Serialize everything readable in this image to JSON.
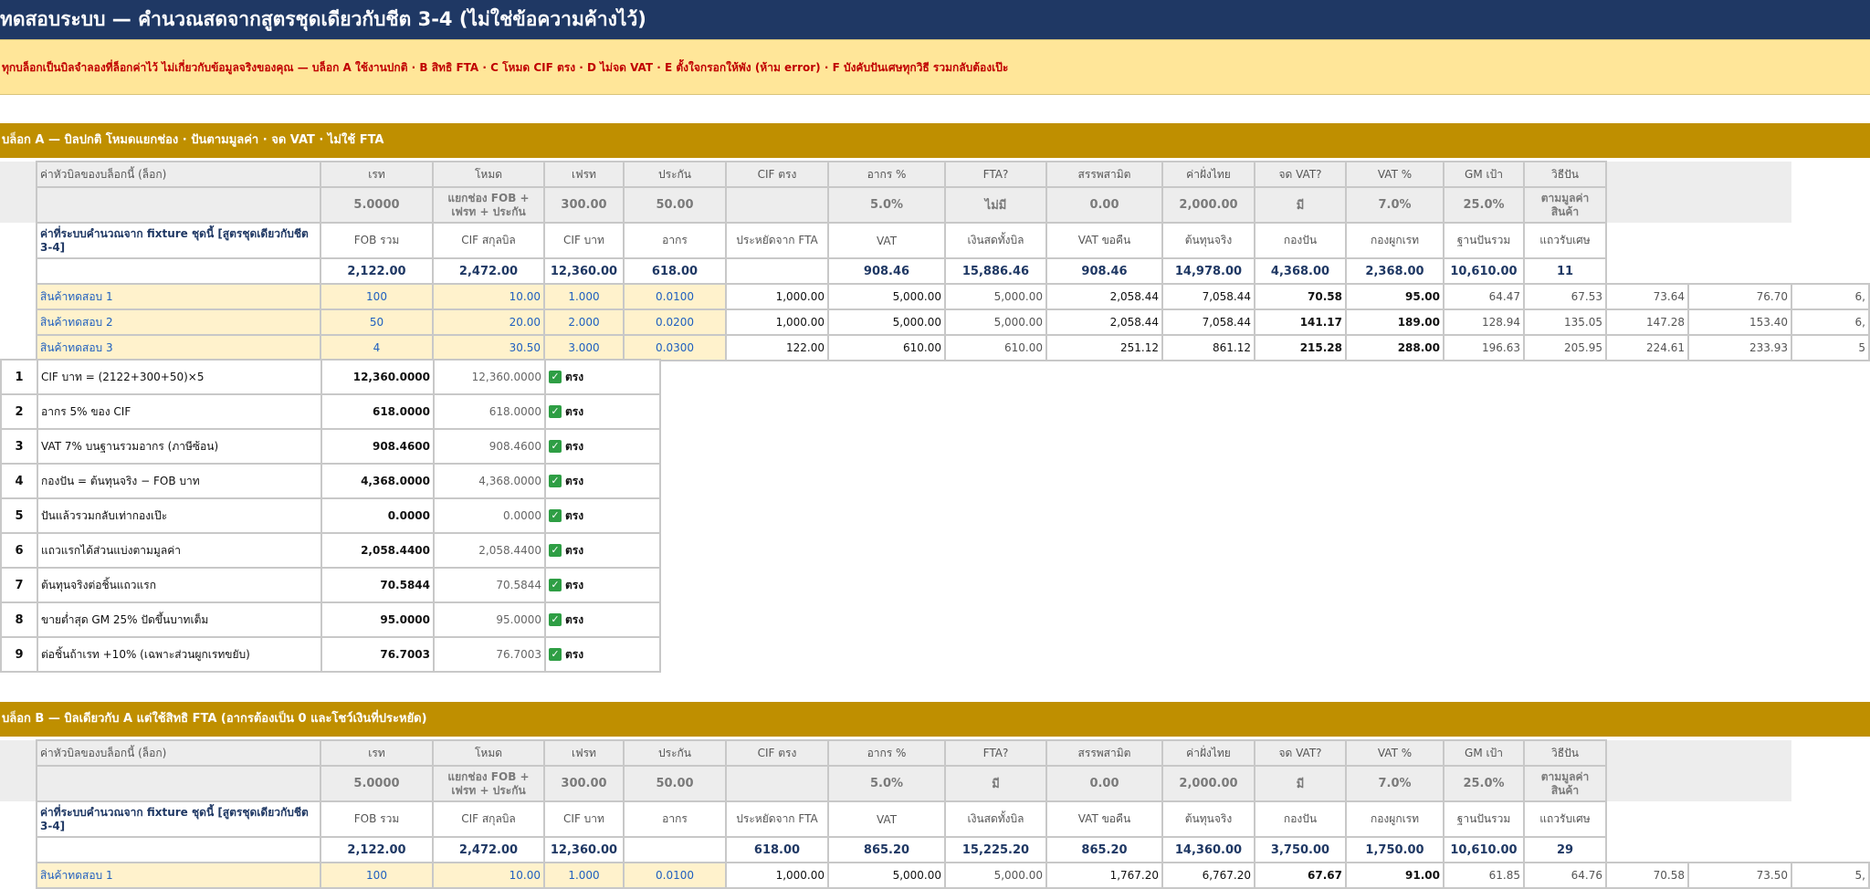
{
  "title": "ทดสอบระบบ — คำนวณสดจากสูตรชุดเดียวกับชีต 3-4 (ไม่ใช่ข้อความค้างไว้)",
  "notice": "ทุกบล็อกเป็นบิลจำลองที่ล็อกค่าไว้ ไม่เกี่ยวกับข้อมูลจริงของคุณ — บล็อก A ใช้งานปกติ · B สิทธิ FTA · C โหมด CIF ตรง · D ไม่จด VAT · E ตั้งใจกรอกให้พัง (ห้าม error) · F บังคับปันเศษทุกวิธี รวมกลับต้องเป๊ะ",
  "headers1": [
    "ค่าหัวบิลของบล็อกนี้ (ล็อก)",
    "เรท",
    "โหมด",
    "เฟรท",
    "ประกัน",
    "CIF ตรง",
    "อากร %",
    "FTA?",
    "สรรพสามิต",
    "ค่าฝั่งไทย",
    "จด VAT?",
    "VAT %",
    "GM เป้า",
    "วิธีปัน"
  ],
  "headers2": [
    "ค่าที่ระบบคำนวณจาก fixture ชุดนี้ [สูตรชุดเดียวกับชีต 3-4]",
    "FOB รวม",
    "CIF สกุลบิล",
    "CIF บาท",
    "อากร",
    "ประหยัดจาก FTA",
    "VAT",
    "เงินสดทั้งบิล",
    "VAT ขอคืน",
    "ต้นทุนจริง",
    "กองปัน",
    "กองผูกเรท",
    "ฐานปันรวม",
    "แถวรับเศษ"
  ],
  "block_a": {
    "title": "บล็อก A — บิลปกติ โหมดแยกช่อง · ปันตามมูลค่า · จด VAT · ไม่ใช้ FTA",
    "inputs": [
      "5.0000",
      "แยกช่อง FOB + เฟรท + ประกัน",
      "300.00",
      "50.00",
      "",
      "5.0%",
      "ไม่มี",
      "0.00",
      "2,000.00",
      "มี",
      "7.0%",
      "25.0%",
      "ตามมูลค่า สินค้า"
    ],
    "totals": [
      "2,122.00",
      "2,472.00",
      "12,360.00",
      "618.00",
      "",
      "908.46",
      "15,886.46",
      "908.46",
      "14,978.00",
      "4,368.00",
      "2,368.00",
      "10,610.00",
      "11"
    ],
    "items": [
      {
        "name": "สินค้าทดสอบ 1",
        "cells": [
          "100",
          "10.00",
          "1.000",
          "0.0100",
          "1,000.00",
          "5,000.00",
          "5,000.00",
          "2,058.44",
          "7,058.44",
          "70.58",
          "95.00",
          "64.47",
          "67.53",
          "73.64",
          "76.70",
          "6,"
        ]
      },
      {
        "name": "สินค้าทดสอบ 2",
        "cells": [
          "50",
          "20.00",
          "2.000",
          "0.0200",
          "1,000.00",
          "5,000.00",
          "5,000.00",
          "2,058.44",
          "7,058.44",
          "141.17",
          "189.00",
          "128.94",
          "135.05",
          "147.28",
          "153.40",
          "6,"
        ]
      },
      {
        "name": "สินค้าทดสอบ 3",
        "cells": [
          "4",
          "30.50",
          "3.000",
          "0.0300",
          "122.00",
          "610.00",
          "610.00",
          "251.12",
          "861.12",
          "215.28",
          "288.00",
          "196.63",
          "205.95",
          "224.61",
          "233.93",
          "5"
        ]
      }
    ],
    "checks": [
      {
        "num": "1",
        "desc": "CIF บาท = (2122+300+50)×5",
        "expected": "12,360.0000",
        "actual": "12,360.0000",
        "status": "ตรง"
      },
      {
        "num": "2",
        "desc": "อากร 5% ของ CIF",
        "expected": "618.0000",
        "actual": "618.0000",
        "status": "ตรง"
      },
      {
        "num": "3",
        "desc": "VAT 7% บนฐานรวมอากร (ภาษีซ้อน)",
        "expected": "908.4600",
        "actual": "908.4600",
        "status": "ตรง"
      },
      {
        "num": "4",
        "desc": "กองปัน = ต้นทุนจริง − FOB บาท",
        "expected": "4,368.0000",
        "actual": "4,368.0000",
        "status": "ตรง"
      },
      {
        "num": "5",
        "desc": "ปันแล้วรวมกลับเท่ากองเป๊ะ",
        "expected": "0.0000",
        "actual": "0.0000",
        "status": "ตรง"
      },
      {
        "num": "6",
        "desc": "แถวแรกได้ส่วนแบ่งตามมูลค่า",
        "expected": "2,058.4400",
        "actual": "2,058.4400",
        "status": "ตรง"
      },
      {
        "num": "7",
        "desc": "ต้นทุนจริงต่อชิ้นแถวแรก",
        "expected": "70.5844",
        "actual": "70.5844",
        "status": "ตรง"
      },
      {
        "num": "8",
        "desc": "ขายต่ำสุด GM 25% ปัดขึ้นบาทเต็ม",
        "expected": "95.0000",
        "actual": "95.0000",
        "status": "ตรง"
      },
      {
        "num": "9",
        "desc": "ต่อชิ้นถ้าเรท +10% (เฉพาะส่วนผูกเรทขยับ)",
        "expected": "76.7003",
        "actual": "76.7003",
        "status": "ตรง"
      }
    ]
  },
  "block_b": {
    "title": "บล็อก B — บิลเดียวกับ A แต่ใช้สิทธิ FTA (อากรต้องเป็น 0 และโชว์เงินที่ประหยัด)",
    "inputs": [
      "5.0000",
      "แยกช่อง FOB + เฟรท + ประกัน",
      "300.00",
      "50.00",
      "",
      "5.0%",
      "มี",
      "0.00",
      "2,000.00",
      "มี",
      "7.0%",
      "25.0%",
      "ตามมูลค่า สินค้า"
    ],
    "totals": [
      "2,122.00",
      "2,472.00",
      "12,360.00",
      "",
      "618.00",
      "865.20",
      "15,225.20",
      "865.20",
      "14,360.00",
      "3,750.00",
      "1,750.00",
      "10,610.00",
      "29"
    ],
    "items": [
      {
        "name": "สินค้าทดสอบ 1",
        "cells": [
          "100",
          "10.00",
          "1.000",
          "0.0100",
          "1,000.00",
          "5,000.00",
          "5,000.00",
          "1,767.20",
          "6,767.20",
          "67.67",
          "91.00",
          "61.85",
          "64.76",
          "70.58",
          "73.50",
          "5,"
        ]
      }
    ]
  },
  "colors": {
    "title_bar": "#1f3864",
    "notice_bg": "#ffe699",
    "notice_text": "#c00000",
    "block_bar": "#bf8f00",
    "input_cell": "#fff2cc",
    "check_icon": "#2e9e44"
  },
  "icons": {
    "check": "check-mark-icon"
  }
}
